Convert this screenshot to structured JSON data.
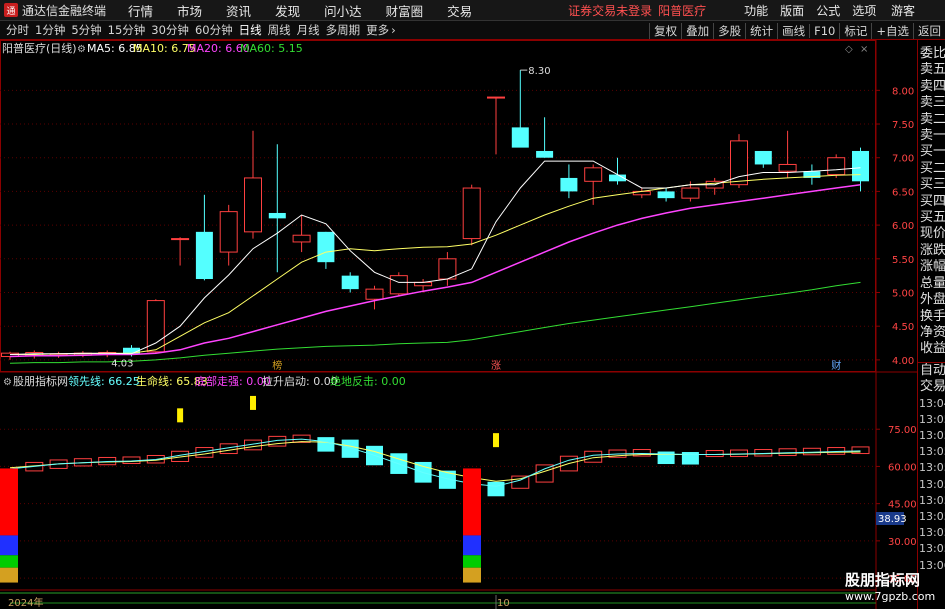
{
  "app": {
    "name": "通达信金融终端"
  },
  "menu": [
    "行情",
    "市场",
    "资讯",
    "发现",
    "问小达",
    "财富圈",
    "交易"
  ],
  "notice": "证券交易未登录",
  "stock_name": "阳普医疗",
  "right_menu": [
    "功能",
    "版面",
    "公式",
    "选项"
  ],
  "guest": "游客",
  "periods": [
    "分时",
    "1分钟",
    "5分钟",
    "15分钟",
    "30分钟",
    "60分钟",
    "日线",
    "周线",
    "月线",
    "多周期",
    "更多"
  ],
  "active_period": "日线",
  "right_tools": [
    "复权",
    "叠加",
    "多股",
    "统计",
    "画线",
    "F10",
    "标记",
    "+自选",
    "返回"
  ],
  "main_panel": {
    "title": "阳普医疗(日线)",
    "ma": [
      {
        "label": "MA5: 6.85",
        "color": "#ffffff"
      },
      {
        "label": "MA10: 6.75",
        "color": "#ffff66"
      },
      {
        "label": "MA20: 6.60",
        "color": "#ff44ff"
      },
      {
        "label": "MA60: 5.15",
        "color": "#33dd33"
      }
    ],
    "max_label": "8.30",
    "min_label": "4.03",
    "markers": [
      {
        "text": "榜",
        "x_index": 11
      },
      {
        "text": "涨",
        "x_index": 20
      },
      {
        "text": "财",
        "x_index": 34
      }
    ]
  },
  "sub_panel": {
    "title": "股朋指标网",
    "items": [
      {
        "label": "领先线: 66.25",
        "color": "#66ffff"
      },
      {
        "label": "生命线: 65.83",
        "color": "#ffff66"
      },
      {
        "label": "底部走强: 0.00",
        "color": "#ff44ff"
      },
      {
        "label": "拉升启动: 0.00",
        "color": "#dddddd"
      },
      {
        "label": "绝地反击: 0.00",
        "color": "#33dd33"
      }
    ],
    "current_value": "38.93"
  },
  "quote_labels": [
    "委比",
    "卖五",
    "卖四",
    "卖三",
    "卖二",
    "卖一",
    "买一",
    "买二",
    "买三",
    "买四",
    "买五",
    "现价",
    "涨跌",
    "涨幅",
    "总量",
    "外盘",
    "换手",
    "净资",
    "收益",
    "自动",
    "交易"
  ],
  "quote_times": [
    "13:04",
    "13:05",
    "13:05",
    "13:05",
    "13:05",
    "13:05",
    "13:05",
    "13:05",
    "13:05",
    "13:05",
    "13:06"
  ],
  "x_axis": {
    "left_label": "2024年",
    "mid_label": "10"
  },
  "watermark": {
    "line1": "股朋指标网",
    "line2": "www.7gpzb.com"
  },
  "chart_data": [
    {
      "type": "candlestick",
      "title": "阳普医疗(日线)",
      "y_ticks": [
        4.0,
        4.5,
        5.0,
        5.5,
        6.0,
        6.5,
        7.0,
        7.5,
        8.0
      ],
      "ylim": [
        3.85,
        8.45
      ],
      "candles": [
        {
          "o": 4.05,
          "h": 4.12,
          "l": 4.0,
          "c": 4.1
        },
        {
          "o": 4.06,
          "h": 4.14,
          "l": 4.02,
          "c": 4.11
        },
        {
          "o": 4.07,
          "h": 4.12,
          "l": 4.03,
          "c": 4.09
        },
        {
          "o": 4.07,
          "h": 4.13,
          "l": 4.04,
          "c": 4.1
        },
        {
          "o": 4.08,
          "h": 4.14,
          "l": 4.04,
          "c": 4.11
        },
        {
          "o": 4.18,
          "h": 4.22,
          "l": 4.05,
          "c": 4.08
        },
        {
          "o": 4.12,
          "h": 4.9,
          "l": 4.1,
          "c": 4.88
        },
        {
          "o": 5.8,
          "h": 5.82,
          "l": 5.4,
          "c": 5.8
        },
        {
          "o": 5.9,
          "h": 6.45,
          "l": 5.18,
          "c": 5.2
        },
        {
          "o": 5.6,
          "h": 6.3,
          "l": 5.4,
          "c": 6.2
        },
        {
          "o": 5.9,
          "h": 7.4,
          "l": 5.8,
          "c": 6.7
        },
        {
          "o": 6.18,
          "h": 7.2,
          "l": 5.3,
          "c": 6.1
        },
        {
          "o": 5.75,
          "h": 6.15,
          "l": 5.6,
          "c": 5.85
        },
        {
          "o": 5.9,
          "h": 5.9,
          "l": 5.35,
          "c": 5.45
        },
        {
          "o": 5.25,
          "h": 5.3,
          "l": 5.0,
          "c": 5.05
        },
        {
          "o": 4.9,
          "h": 5.1,
          "l": 4.75,
          "c": 5.05
        },
        {
          "o": 4.98,
          "h": 5.3,
          "l": 4.95,
          "c": 5.25
        },
        {
          "o": 5.1,
          "h": 5.2,
          "l": 5.0,
          "c": 5.15
        },
        {
          "o": 5.2,
          "h": 5.6,
          "l": 5.1,
          "c": 5.5
        },
        {
          "o": 5.8,
          "h": 6.6,
          "l": 5.7,
          "c": 6.55
        },
        {
          "o": 7.9,
          "h": 7.9,
          "l": 7.05,
          "c": 7.9
        },
        {
          "o": 7.45,
          "h": 8.3,
          "l": 7.2,
          "c": 7.15
        },
        {
          "o": 7.1,
          "h": 7.6,
          "l": 7.0,
          "c": 7.0
        },
        {
          "o": 6.7,
          "h": 6.9,
          "l": 6.4,
          "c": 6.5
        },
        {
          "o": 6.65,
          "h": 6.9,
          "l": 6.3,
          "c": 6.85
        },
        {
          "o": 6.75,
          "h": 7.0,
          "l": 6.6,
          "c": 6.65
        },
        {
          "o": 6.45,
          "h": 6.55,
          "l": 6.4,
          "c": 6.5
        },
        {
          "o": 6.5,
          "h": 6.55,
          "l": 6.35,
          "c": 6.4
        },
        {
          "o": 6.4,
          "h": 6.65,
          "l": 6.35,
          "c": 6.55
        },
        {
          "o": 6.55,
          "h": 6.7,
          "l": 6.45,
          "c": 6.65
        },
        {
          "o": 6.6,
          "h": 7.35,
          "l": 6.55,
          "c": 7.25
        },
        {
          "o": 7.1,
          "h": 7.1,
          "l": 6.85,
          "c": 6.9
        },
        {
          "o": 6.8,
          "h": 7.4,
          "l": 6.7,
          "c": 6.9
        },
        {
          "o": 6.8,
          "h": 6.9,
          "l": 6.6,
          "c": 6.7
        },
        {
          "o": 6.75,
          "h": 7.05,
          "l": 6.7,
          "c": 7.0
        },
        {
          "o": 7.1,
          "h": 7.15,
          "l": 6.5,
          "c": 6.65
        }
      ],
      "ma5": [
        4.08,
        4.09,
        4.09,
        4.1,
        4.1,
        4.09,
        4.25,
        4.5,
        4.92,
        5.26,
        5.65,
        5.88,
        6.15,
        6.02,
        5.62,
        5.3,
        5.15,
        5.15,
        5.2,
        5.35,
        6.05,
        6.55,
        6.95,
        6.95,
        6.95,
        6.75,
        6.55,
        6.55,
        6.6,
        6.6,
        6.72,
        6.78,
        6.78,
        6.8,
        6.82,
        6.85
      ],
      "ma10": [
        4.08,
        4.08,
        4.09,
        4.09,
        4.1,
        4.1,
        4.15,
        4.35,
        4.55,
        4.7,
        4.95,
        5.2,
        5.45,
        5.6,
        5.65,
        5.62,
        5.65,
        5.67,
        5.68,
        5.72,
        5.85,
        6.0,
        6.15,
        6.28,
        6.4,
        6.45,
        6.5,
        6.55,
        6.6,
        6.62,
        6.65,
        6.68,
        6.7,
        6.72,
        6.74,
        6.75
      ],
      "ma20": [
        4.05,
        4.06,
        4.06,
        4.07,
        4.08,
        4.08,
        4.1,
        4.15,
        4.25,
        4.32,
        4.42,
        4.52,
        4.62,
        4.72,
        4.8,
        4.88,
        4.95,
        5.02,
        5.08,
        5.15,
        5.3,
        5.45,
        5.6,
        5.75,
        5.88,
        6.0,
        6.1,
        6.18,
        6.25,
        6.3,
        6.35,
        6.4,
        6.45,
        6.5,
        6.55,
        6.6
      ],
      "ma60": [
        3.95,
        3.96,
        3.96,
        3.97,
        3.97,
        3.98,
        4.0,
        4.03,
        4.07,
        4.1,
        4.13,
        4.16,
        4.18,
        4.2,
        4.21,
        4.22,
        4.24,
        4.25,
        4.26,
        4.3,
        4.36,
        4.42,
        4.48,
        4.54,
        4.59,
        4.64,
        4.69,
        4.74,
        4.79,
        4.84,
        4.89,
        4.94,
        4.99,
        5.04,
        5.1,
        5.15
      ]
    },
    {
      "type": "bar",
      "title": "股朋指标网",
      "y_ticks": [
        15.0,
        30.0,
        45.0,
        60.0,
        75.0
      ],
      "ylim": [
        11,
        90
      ],
      "lead": [
        59.0,
        60.0,
        61.0,
        61.5,
        62.0,
        62.2,
        62.8,
        64.5,
        66.0,
        67.5,
        69.0,
        70.5,
        71.0,
        70.0,
        67.5,
        64.5,
        61.0,
        57.5,
        55.0,
        53.0,
        52.0,
        54.5,
        59.0,
        62.5,
        64.5,
        65.0,
        65.2,
        65.0,
        64.8,
        64.8,
        65.0,
        65.2,
        65.5,
        65.7,
        66.0,
        66.25
      ],
      "life": [
        59.5,
        60.2,
        61.0,
        61.5,
        61.8,
        62.0,
        62.5,
        63.8,
        65.0,
        66.5,
        68.0,
        69.2,
        70.0,
        69.8,
        68.2,
        66.0,
        63.0,
        60.0,
        57.5,
        55.5,
        54.0,
        55.0,
        58.0,
        61.2,
        63.5,
        64.3,
        64.8,
        64.8,
        64.8,
        64.8,
        64.9,
        65.1,
        65.3,
        65.5,
        65.7,
        65.83
      ],
      "spikes": [
        {
          "x_index": 7,
          "value": 81
        },
        {
          "x_index": 10,
          "value": 86
        },
        {
          "x_index": 20,
          "value": 71
        }
      ]
    }
  ]
}
